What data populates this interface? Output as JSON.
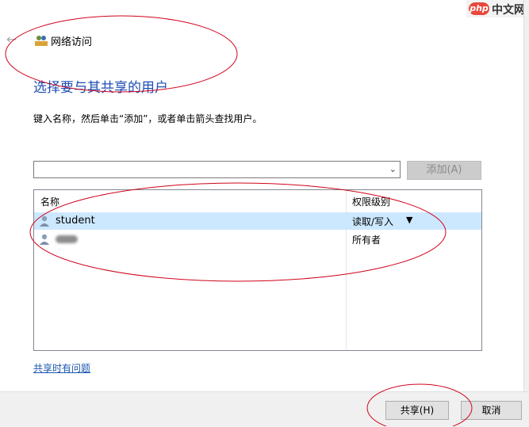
{
  "watermark": {
    "logo": "php",
    "text": "中文网"
  },
  "window": {
    "title": "网络访问"
  },
  "heading": "选择要与其共享的用户",
  "instruction": "键入名称，然后单击“添加”，或者单击箭头查找用户。",
  "combo": {
    "value": ""
  },
  "add_button": "添加(A)",
  "table": {
    "headers": {
      "name": "名称",
      "permission": "权限级别"
    },
    "rows": [
      {
        "name": "student",
        "permission": "读取/写入",
        "selected": true
      },
      {
        "name": "",
        "permission": "所有者",
        "selected": false
      }
    ]
  },
  "help_link": "共享时有问题",
  "buttons": {
    "share": "共享(H)",
    "cancel": "取消"
  },
  "colors": {
    "heading": "#1e4eb5",
    "selection": "#cce8ff",
    "annotation": "#d0021b",
    "link": "#1a56b0"
  }
}
